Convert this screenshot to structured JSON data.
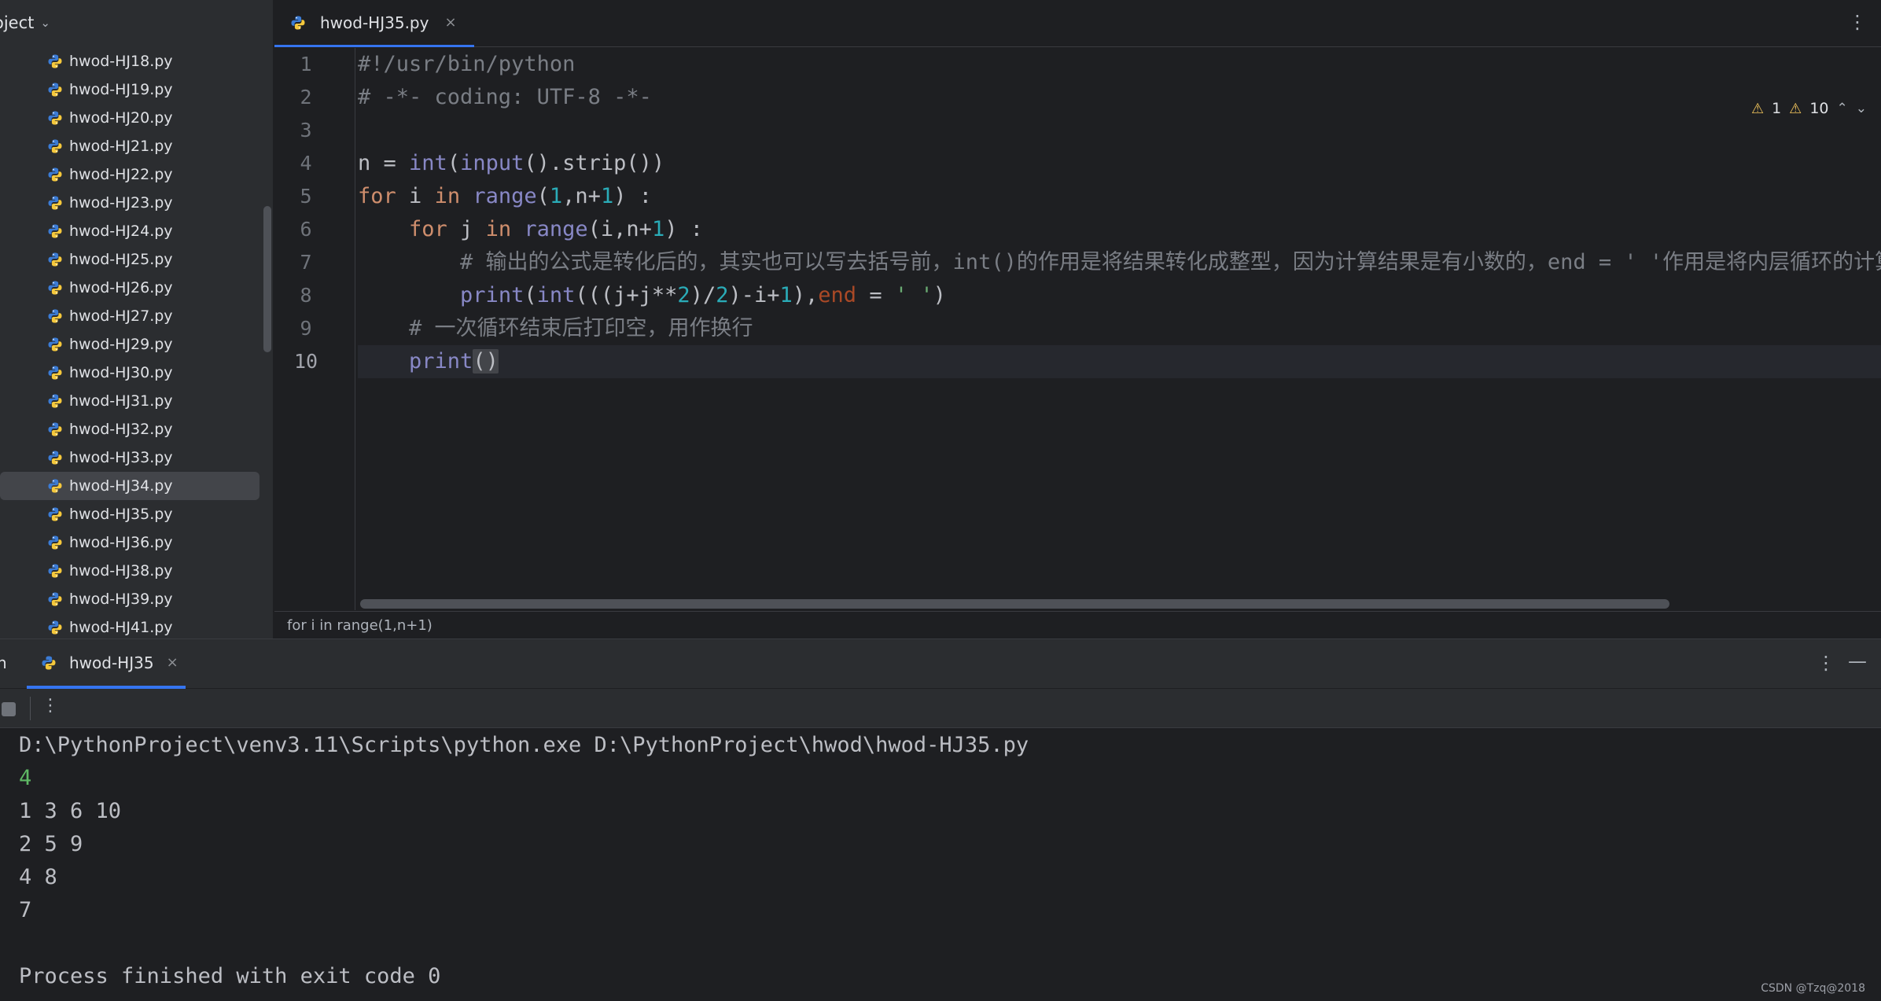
{
  "sidebar": {
    "title": "oject",
    "files": [
      {
        "name": "hwod-HJ18.py",
        "selected": false
      },
      {
        "name": "hwod-HJ19.py",
        "selected": false
      },
      {
        "name": "hwod-HJ20.py",
        "selected": false
      },
      {
        "name": "hwod-HJ21.py",
        "selected": false
      },
      {
        "name": "hwod-HJ22.py",
        "selected": false
      },
      {
        "name": "hwod-HJ23.py",
        "selected": false
      },
      {
        "name": "hwod-HJ24.py",
        "selected": false
      },
      {
        "name": "hwod-HJ25.py",
        "selected": false
      },
      {
        "name": "hwod-HJ26.py",
        "selected": false
      },
      {
        "name": "hwod-HJ27.py",
        "selected": false
      },
      {
        "name": "hwod-HJ29.py",
        "selected": false
      },
      {
        "name": "hwod-HJ30.py",
        "selected": false
      },
      {
        "name": "hwod-HJ31.py",
        "selected": false
      },
      {
        "name": "hwod-HJ32.py",
        "selected": false
      },
      {
        "name": "hwod-HJ33.py",
        "selected": false
      },
      {
        "name": "hwod-HJ34.py",
        "selected": true
      },
      {
        "name": "hwod-HJ35.py",
        "selected": false
      },
      {
        "name": "hwod-HJ36.py",
        "selected": false
      },
      {
        "name": "hwod-HJ38.py",
        "selected": false
      },
      {
        "name": "hwod-HJ39.py",
        "selected": false
      },
      {
        "name": "hwod-HJ41.py",
        "selected": false
      }
    ]
  },
  "editor": {
    "tab_label": "hwod-HJ35.py",
    "tab_close": "×",
    "menu_icon": "⋮",
    "inspection": {
      "warnings": "1",
      "weak_warnings": "10"
    },
    "line_numbers": [
      "1",
      "2",
      "3",
      "4",
      "5",
      "6",
      "7",
      "8",
      "9",
      "10"
    ],
    "current_line": "10",
    "code": [
      "#!/usr/bin/python",
      "# -*- coding: UTF-8 -*-",
      "",
      "n = int(input().strip())",
      "for i in range(1,n+1) :",
      "    for j in range(i,n+1) :",
      "        # 输出的公式是转化后的，其实也可以写去括号前，int()的作用是将结果转化成整型，因为计算结果是有小数的，end = ' '作用是将内层循环的计算",
      "        print(int(((j+j**2)/2)-i+1),end = ' ')",
      "    # 一次循环结束后打印空，用作换行",
      "    print()"
    ],
    "breadcrumb": "for i in range(1,n+1)"
  },
  "run": {
    "tool_label": "n",
    "tab_label": "hwod-HJ35",
    "tab_close": "×",
    "console": [
      {
        "text": "D:\\PythonProject\\venv3.11\\Scripts\\python.exe D:\\PythonProject\\hwod\\hwod-HJ35.py",
        "kind": "output"
      },
      {
        "text": "4",
        "kind": "input"
      },
      {
        "text": "1 3 6 10",
        "kind": "output"
      },
      {
        "text": "2 5 9",
        "kind": "output"
      },
      {
        "text": "4 8",
        "kind": "output"
      },
      {
        "text": "7",
        "kind": "output"
      },
      {
        "text": "",
        "kind": "output"
      },
      {
        "text": "Process finished with exit code 0",
        "kind": "output"
      }
    ]
  },
  "watermark": "CSDN @Tzq@2018",
  "colors": {
    "background": "#1e1f22",
    "panel": "#2b2d30",
    "accent": "#3574f0",
    "keyword": "#cf8e6d",
    "builtin": "#8888c6",
    "number": "#2aacb8",
    "string": "#6aab73",
    "comment": "#7a7e85",
    "console_input": "#5fb865",
    "warning": "#f2c55c"
  },
  "icons": {
    "file": "python-file-icon",
    "chevron": "chevron-down-icon",
    "warning": "warning-triangle-icon",
    "stop": "stop-icon",
    "more": "more-vertical-icon",
    "minimize": "minimize-icon"
  }
}
